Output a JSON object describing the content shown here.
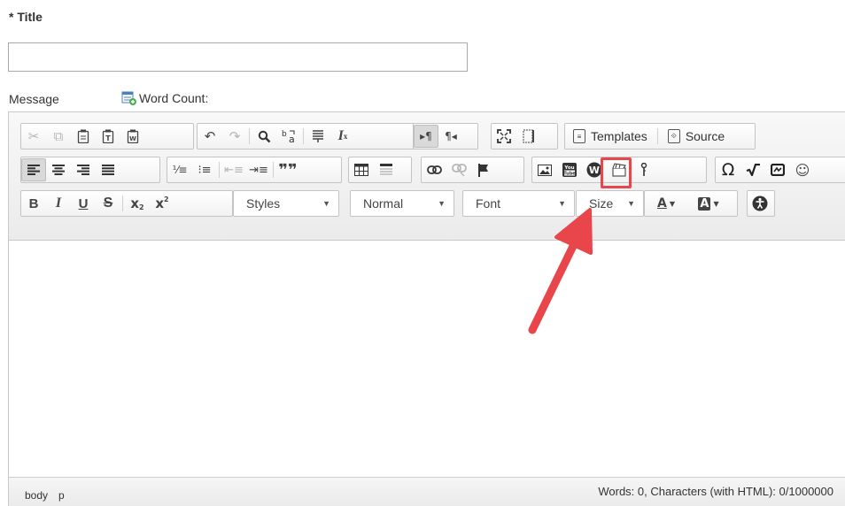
{
  "form": {
    "title_label": "* Title",
    "title_value": "",
    "message_label": "Message",
    "word_count_label": "Word Count:"
  },
  "toolbar": {
    "row1": {
      "clipboard": [
        "cut-icon",
        "copy-icon",
        "paste-icon",
        "paste-text-icon",
        "paste-word-icon"
      ],
      "history": [
        "undo-icon",
        "redo-icon"
      ],
      "find": [
        "find-icon",
        "replace-icon"
      ],
      "other": [
        "select-all-icon",
        "remove-format-icon"
      ],
      "direction": [
        "ltr-icon",
        "rtl-icon"
      ],
      "view": [
        "maximize-icon",
        "show-blocks-icon"
      ],
      "templates_label": "Templates",
      "source_label": "Source"
    },
    "row2": {
      "align": [
        "align-left-icon",
        "align-center-icon",
        "align-right-icon",
        "justify-icon"
      ],
      "lists": [
        "numbered-list-icon",
        "bulleted-list-icon",
        "outdent-icon",
        "indent-icon",
        "blockquote-icon"
      ],
      "table": [
        "table-icon",
        "horizontal-rule-icon"
      ],
      "links": [
        "link-icon",
        "unlink-icon",
        "anchor-icon"
      ],
      "media": [
        "image-icon",
        "youtube-icon",
        "wiris-icon",
        "video-icon",
        "accessibility-pin-icon"
      ],
      "insert": [
        "special-char-icon",
        "math-icon",
        "embed-icon",
        "emoji-icon"
      ],
      "youtube_text": "You Tube",
      "omega": "Ω"
    },
    "row3": {
      "bold": "B",
      "italic": "I",
      "underline": "U",
      "strike": "S",
      "subscript": "x",
      "superscript": "x",
      "styles_label": "Styles",
      "format_label": "Normal",
      "font_label": "Font",
      "size_label": "Size",
      "text_color_label": "A",
      "bg_color_label": "A"
    }
  },
  "statusbar": {
    "path": [
      "body",
      "p"
    ],
    "count_text": "Words: 0, Characters (with HTML): 0/1000000"
  },
  "colors": {
    "highlight": "#e8464b",
    "arrow": "#e8464b"
  }
}
